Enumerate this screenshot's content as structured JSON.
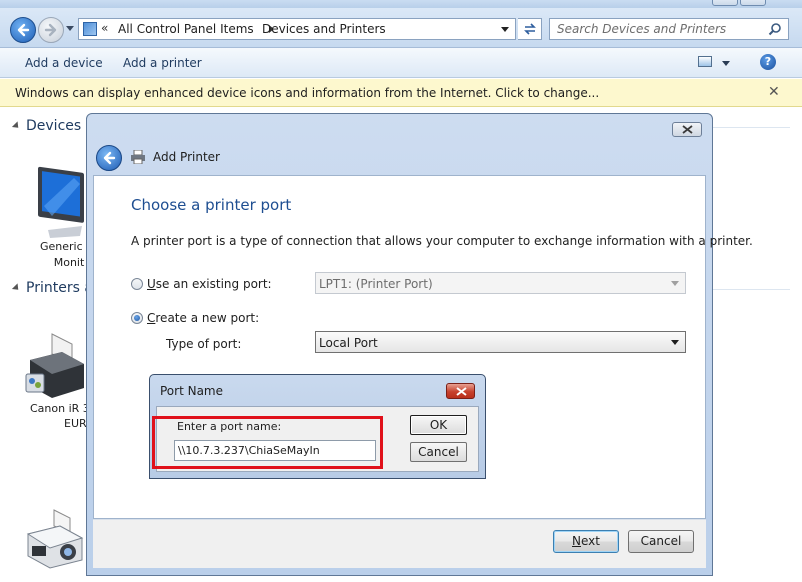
{
  "explorer": {
    "breadcrumb": {
      "overflow": "«",
      "items": [
        "All Control Panel Items",
        "Devices and Printers"
      ]
    },
    "search": {
      "placeholder": "Search Devices and Printers"
    },
    "commands": [
      "Add a device",
      "Add a printer"
    ],
    "infobar": {
      "message": "Windows can display enhanced device icons and information from the Internet. Click to change..."
    },
    "groups": [
      {
        "title": "Devices ("
      },
      {
        "title": "Printers a"
      }
    ],
    "devices": [
      {
        "line1": "Generic",
        "line2": "Monit"
      }
    ],
    "printers": [
      {
        "line1": "Canon iR 3",
        "line2": "EUR"
      }
    ]
  },
  "add_printer": {
    "title": "Add Printer",
    "heading": "Choose a printer port",
    "description": "A printer port is a type of connection that allows your computer to exchange information with a printer.",
    "use_existing": {
      "label_prefix": "U",
      "label_rest": "se an existing port:",
      "selected": false,
      "value": "LPT1: (Printer Port)"
    },
    "create_new": {
      "label_prefix": "C",
      "label_rest": "reate a new port:",
      "selected": true
    },
    "type_of_port": {
      "label": "Type of port:",
      "value": "Local Port"
    },
    "next": {
      "prefix": "N",
      "rest": "ext"
    },
    "cancel": "Cancel"
  },
  "port_name_dialog": {
    "title": "Port Name",
    "prompt": "Enter a port name:",
    "value": "\\\\10.7.3.237\\ChiaSeMayIn",
    "ok": "OK",
    "cancel": "Cancel",
    "highlight_color": "#e0101a"
  }
}
